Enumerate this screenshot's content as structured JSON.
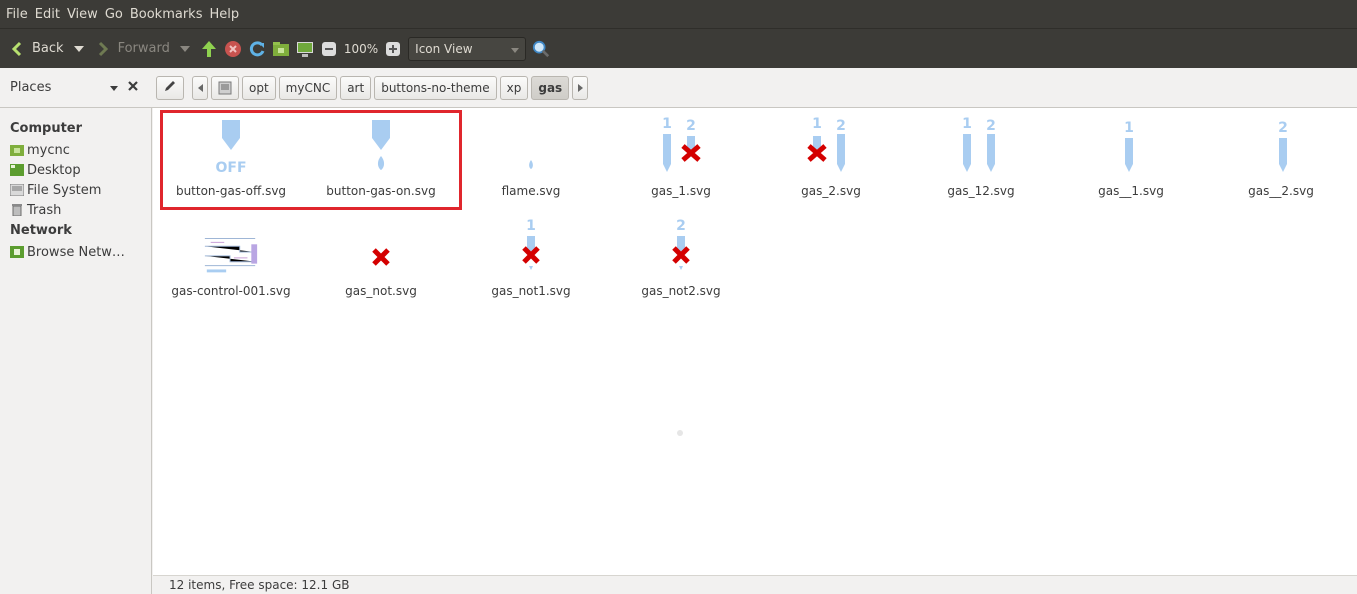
{
  "menu": [
    "File",
    "Edit",
    "View",
    "Go",
    "Bookmarks",
    "Help"
  ],
  "toolbar": {
    "back_label": "Back",
    "forward_label": "Forward",
    "zoom": "100%",
    "view_mode": "Icon View"
  },
  "places": {
    "label": "Places"
  },
  "breadcrumbs": [
    "opt",
    "myCNC",
    "art",
    "buttons-no-theme",
    "xp",
    "gas"
  ],
  "sidebar": {
    "computer_heading": "Computer",
    "computer_items": [
      {
        "label": "mycnc",
        "icon": "home-folder-icon"
      },
      {
        "label": "Desktop",
        "icon": "desktop-icon"
      },
      {
        "label": "File System",
        "icon": "drive-icon"
      },
      {
        "label": "Trash",
        "icon": "trash-icon"
      }
    ],
    "network_heading": "Network",
    "network_items": [
      {
        "label": "Browse Netw…",
        "icon": "network-icon"
      }
    ]
  },
  "files": [
    {
      "name": "button-gas-off.svg"
    },
    {
      "name": "button-gas-on.svg"
    },
    {
      "name": "flame.svg"
    },
    {
      "name": "gas_1.svg"
    },
    {
      "name": "gas_2.svg"
    },
    {
      "name": "gas_12.svg"
    },
    {
      "name": "gas__1.svg"
    },
    {
      "name": "gas__2.svg"
    },
    {
      "name": "gas-control-001.svg"
    },
    {
      "name": "gas_not.svg"
    },
    {
      "name": "gas_not1.svg"
    },
    {
      "name": "gas_not2.svg"
    }
  ],
  "thumb_text": {
    "off": "OFF",
    "one": "1",
    "two": "2"
  },
  "status": "12 items, Free space: 12.1 GB",
  "colors": {
    "nozzle": "#a9cdf1",
    "cross": "#d40000",
    "highlight": "#e0262d"
  }
}
